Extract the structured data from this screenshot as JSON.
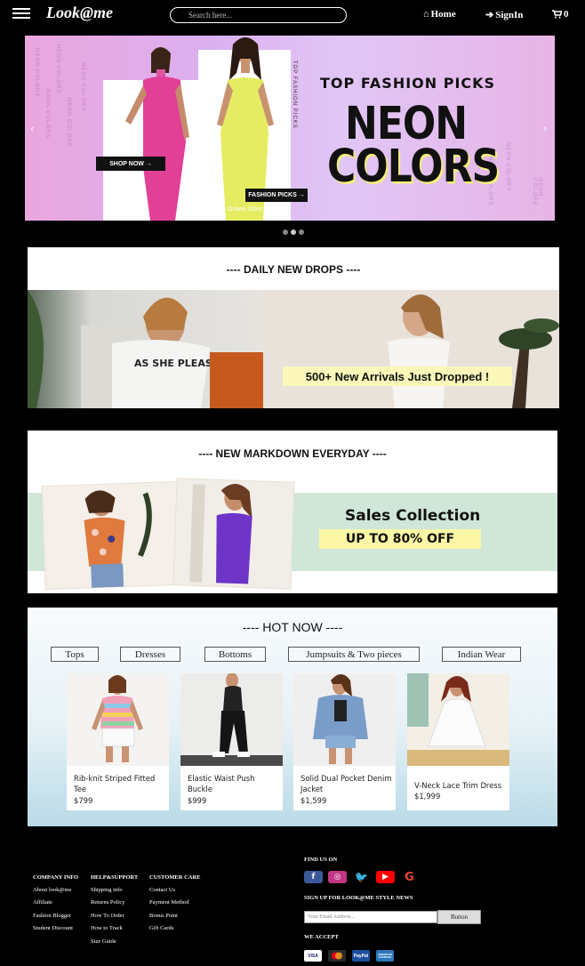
{
  "nav": {
    "logo": "Look@me",
    "search_placeholder": "Search here...",
    "home": "Home",
    "signin": "SignIn",
    "cart_count": "0"
  },
  "hero": {
    "shop_now": "SHOP NOW →",
    "fashion_picks": "FASHION PICKS →",
    "top_line": "TOP FASHION PICKS",
    "big_line1": "NEON",
    "big_line2": "COLORS",
    "small_caption": "Online Store",
    "vertical_text": "TOP FASHION PICKS",
    "side_text": "NEON COLORS",
    "prev_arrow": "‹",
    "next_arrow": "›",
    "slides": 3,
    "active_slide": 1
  },
  "daily": {
    "heading": "---- DAILY NEW DROPS ----",
    "shirt_text": "AS SHE PLEASE",
    "banner": "500+ New Arrivals Just Dropped !"
  },
  "markdown": {
    "heading": "---- NEW MARKDOWN EVERYDAY ----",
    "title": "Sales Collection",
    "tag": "UP TO 80% OFF"
  },
  "hot": {
    "heading": "---- HOT NOW ----",
    "tabs": [
      "Tops",
      "Dresses",
      "Bottoms",
      "Jumpsuits & Two pieces",
      "Indian Wear"
    ],
    "products": [
      {
        "name": "Rib-knit Striped Fitted Tee",
        "price": "$799"
      },
      {
        "name": "Elastic Waist Push Buckle",
        "price": "$999"
      },
      {
        "name": "Solid Dual Pocket Denim Jacket",
        "price": "$1,599"
      },
      {
        "name": "V-Neck Lace Trim Dress",
        "price": "$1,999"
      }
    ]
  },
  "footer": {
    "col1_title": "COMPANY INFO",
    "col1": [
      "About look@me",
      "Affiliate",
      "Fashion Blogger",
      "Student Discount"
    ],
    "col2_title": "HELP&SUPPORT",
    "col2": [
      "Shipping info",
      "Returns Policy",
      "How To Order",
      "How to Track",
      "Size Guide"
    ],
    "col3_title": "CUSTOMER CARE",
    "col3": [
      "Contact Us",
      "Payment Method",
      "Bonus Point",
      "Gift Cards"
    ],
    "find_us": "FIND US ON",
    "signup": "SIGN UP FOR LOOK@ME STYLE NEWS",
    "email_placeholder": "Your Email Address...",
    "button": "Button",
    "we_accept": "WE ACCEPT",
    "payments": [
      "VISA",
      "mastercard",
      "PayPal",
      "AMERICAN EXPRESS"
    ],
    "colors": {
      "facebook": "#3b5998",
      "instagram": "#c13584",
      "twitter": "#1da1f2",
      "youtube": "#ff0000",
      "google": "#ffffff"
    }
  }
}
